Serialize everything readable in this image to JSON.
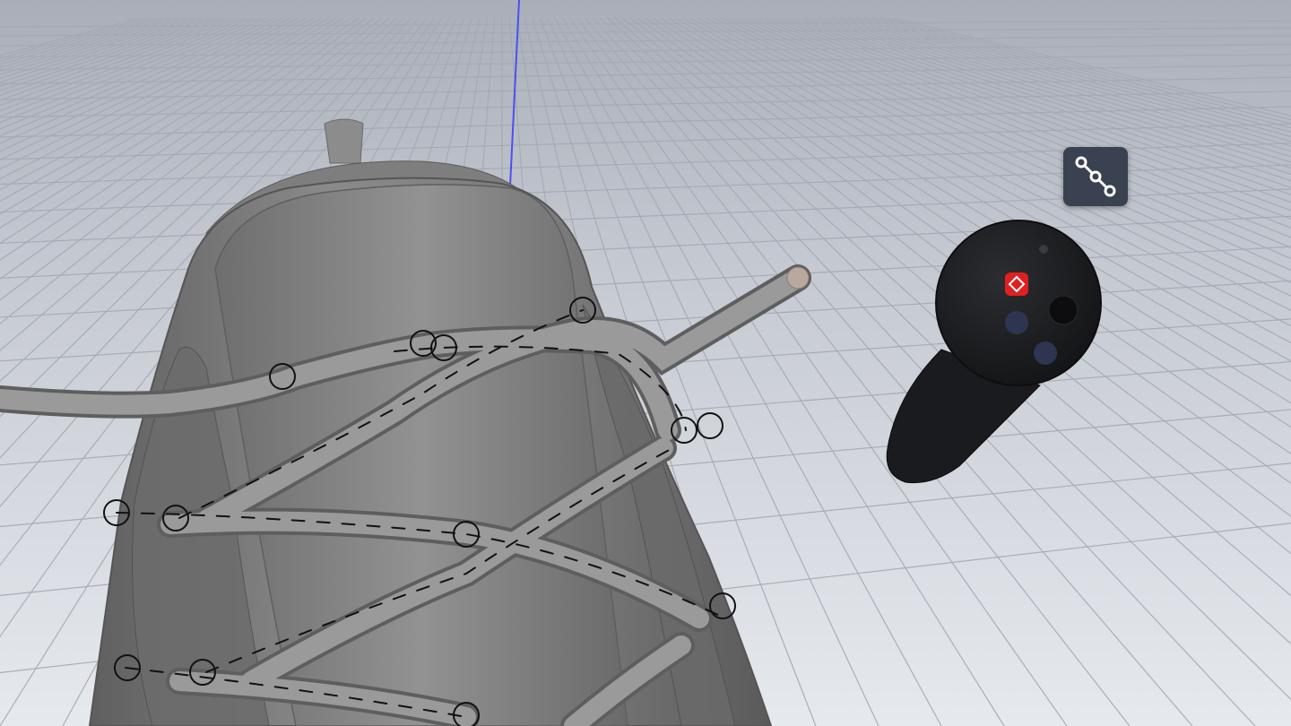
{
  "scene": {
    "background_colors": {
      "sky_top": "#b7bcc6",
      "floor": "#e4e8ee",
      "grid_line": "#a9afb9"
    },
    "model": {
      "name": "shoe-lacing-model",
      "shoe_color": "#7b7b7b",
      "lace_color": "#8a8a8a"
    },
    "axis_color": "#4c4ff0"
  },
  "toolbar": {
    "active_tool_icon": "path-nodes-icon",
    "badge_color": "#3a4150"
  },
  "controller": {
    "body_color": "#1e1f22",
    "accent_color": "#e02020",
    "button_color": "#2d3550"
  }
}
